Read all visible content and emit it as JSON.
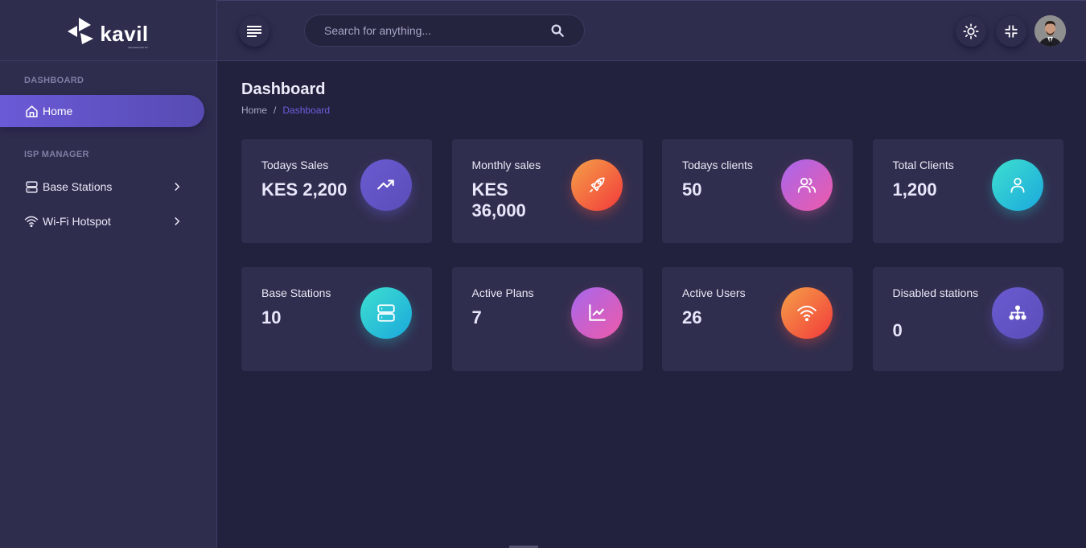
{
  "brand": {
    "name": "kavil",
    "tagline": "Empowerment Inc."
  },
  "sidebar": {
    "sections": [
      {
        "title": "DASHBOARD"
      },
      {
        "title": "ISP MANAGER"
      }
    ],
    "items": [
      {
        "label": "Home",
        "icon": "home-icon",
        "active": true
      },
      {
        "label": "Base Stations",
        "icon": "server-icon",
        "has_submenu": true
      },
      {
        "label": "Wi-Fi Hotspot",
        "icon": "wifi-icon",
        "has_submenu": true
      }
    ]
  },
  "header": {
    "search": {
      "placeholder": "Search for anything...",
      "value": ""
    },
    "icons": [
      "menu-icon",
      "search-icon",
      "sun-icon",
      "minimize-icon",
      "avatar"
    ]
  },
  "page": {
    "title": "Dashboard",
    "breadcrumb": [
      {
        "label": "Home"
      },
      {
        "separator": "/"
      },
      {
        "label": "Dashboard",
        "current": true
      }
    ]
  },
  "stats": [
    {
      "title": "Todays Sales",
      "value": "KES 2,200",
      "icon": "trending-up-icon",
      "color": "purple"
    },
    {
      "title": "Monthly sales",
      "value": "KES 36,000",
      "icon": "rocket-icon",
      "color": "orange"
    },
    {
      "title": "Todays clients",
      "value": "50",
      "icon": "users-icon",
      "color": "pink"
    },
    {
      "title": "Total Clients",
      "value": "1,200",
      "icon": "user-icon",
      "color": "teal"
    },
    {
      "title": "Base Stations",
      "value": "10",
      "icon": "server-icon",
      "color": "teal"
    },
    {
      "title": "Active Plans",
      "value": "7",
      "icon": "chart-line-icon",
      "color": "pink"
    },
    {
      "title": "Active Users",
      "value": "26",
      "icon": "wifi-icon",
      "color": "orange"
    },
    {
      "title": "Disabled stations",
      "value": "0",
      "icon": "sitemap-icon",
      "color": "purple"
    }
  ],
  "colors": {
    "accent": "#6a5ad6",
    "background": "#22223e",
    "panel": "#2f2d4e",
    "card": "#302e4e",
    "breadcrumb_active": "#6c5ee0"
  }
}
